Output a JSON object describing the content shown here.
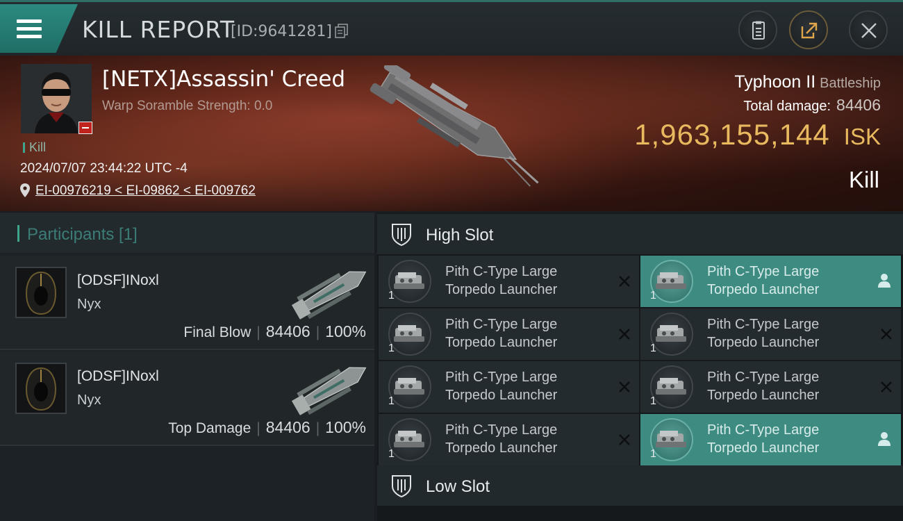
{
  "header": {
    "title": "KILL REPORT",
    "report_id": "[ID:9641281]",
    "icons": [
      "menu-icon",
      "copy-icon",
      "report-icon",
      "share-icon",
      "close-icon"
    ]
  },
  "victim": {
    "name": "[NETX]Assassin' Creed",
    "warp_scramble": "Warp Soramble Strength: 0.0",
    "kill_tag": "Kill",
    "timestamp": "2024/07/07 23:44:22 UTC -4",
    "location": "EI-00976219 < EI-09862 < EI-009762",
    "ship_name": "Typhoon II",
    "ship_class": "Battleship",
    "total_damage_label": "Total damage:",
    "total_damage": "84406",
    "isk_value": "1,963,155,144",
    "isk_unit": "ISK",
    "result": "Kill"
  },
  "participants": {
    "label": "Participants [1]",
    "rows": [
      {
        "name": "[ODSF]INoxl",
        "ship": "Nyx",
        "role": "Final Blow",
        "damage": "84406",
        "percent": "100%"
      },
      {
        "name": "[ODSF]INoxl",
        "ship": "Nyx",
        "role": "Top Damage",
        "damage": "84406",
        "percent": "100%"
      }
    ]
  },
  "slots": {
    "high_label": "High Slot",
    "low_label": "Low Slot",
    "high_modules": [
      {
        "line1": "Pith C-Type Large",
        "line2": "Torpedo Launcher",
        "qty": "1",
        "status": "destroyed"
      },
      {
        "line1": "Pith C-Type Large",
        "line2": "Torpedo Launcher",
        "qty": "1",
        "status": "dropped"
      },
      {
        "line1": "Pith C-Type Large",
        "line2": "Torpedo Launcher",
        "qty": "1",
        "status": "destroyed"
      },
      {
        "line1": "Pith C-Type Large",
        "line2": "Torpedo Launcher",
        "qty": "1",
        "status": "destroyed"
      },
      {
        "line1": "Pith C-Type Large",
        "line2": "Torpedo Launcher",
        "qty": "1",
        "status": "destroyed"
      },
      {
        "line1": "Pith C-Type Large",
        "line2": "Torpedo Launcher",
        "qty": "1",
        "status": "destroyed"
      },
      {
        "line1": "Pith C-Type Large",
        "line2": "Torpedo Launcher",
        "qty": "1",
        "status": "destroyed"
      },
      {
        "line1": "Pith C-Type Large",
        "line2": "Torpedo Launcher",
        "qty": "1",
        "status": "dropped"
      }
    ]
  },
  "colors": {
    "accent_teal": "#3e8b82",
    "isk_gold": "#e8b95e",
    "hero_red": "#5a2418"
  }
}
